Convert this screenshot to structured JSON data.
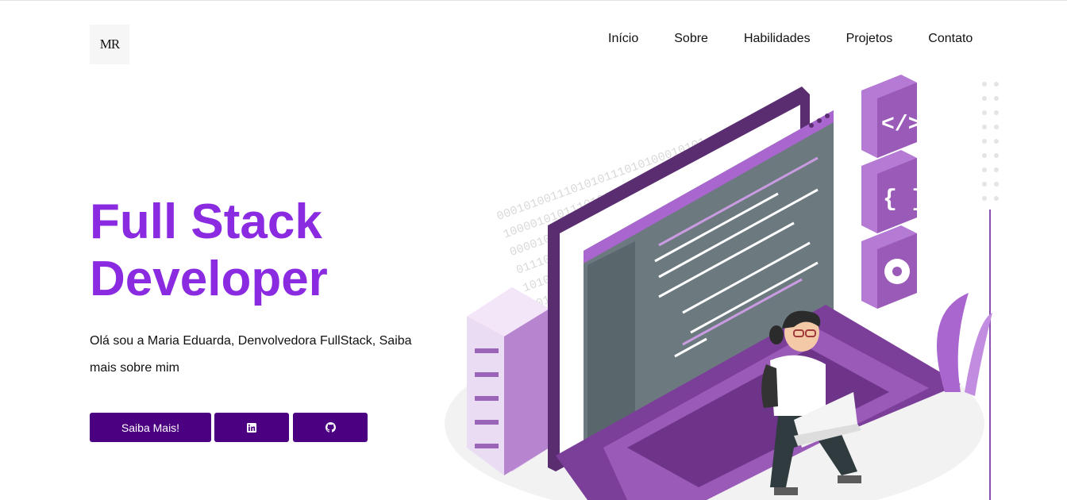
{
  "logo": {
    "text": "MR"
  },
  "nav": {
    "items": [
      "Início",
      "Sobre",
      "Habilidades",
      "Projetos",
      "Contato"
    ]
  },
  "hero": {
    "title_line1": "Full Stack",
    "title_line2": "Developer",
    "description": "Olá sou a Maria Eduarda, Denvolvedora FullStack, Saiba mais sobre mim",
    "primary_button": "Saiba Mais!",
    "linkedin_icon": "linkedin-icon",
    "github_icon": "github-icon"
  },
  "illustration": {
    "binary_text": [
      "0001010011101010111010100010101",
      "1000010101110101011001010101100",
      "0000101000101010001010110101010",
      "0111010001010100010101010101010",
      "1010100101010100010100101010010",
      "1010100101"
    ],
    "icons": [
      "code-tag-icon",
      "braces-icon",
      "gear-icon"
    ]
  },
  "colors": {
    "accent": "#8a2be2",
    "button": "#4b0082",
    "illustration_purple": "#7b3f99",
    "illustration_light": "#c9a0dc"
  }
}
